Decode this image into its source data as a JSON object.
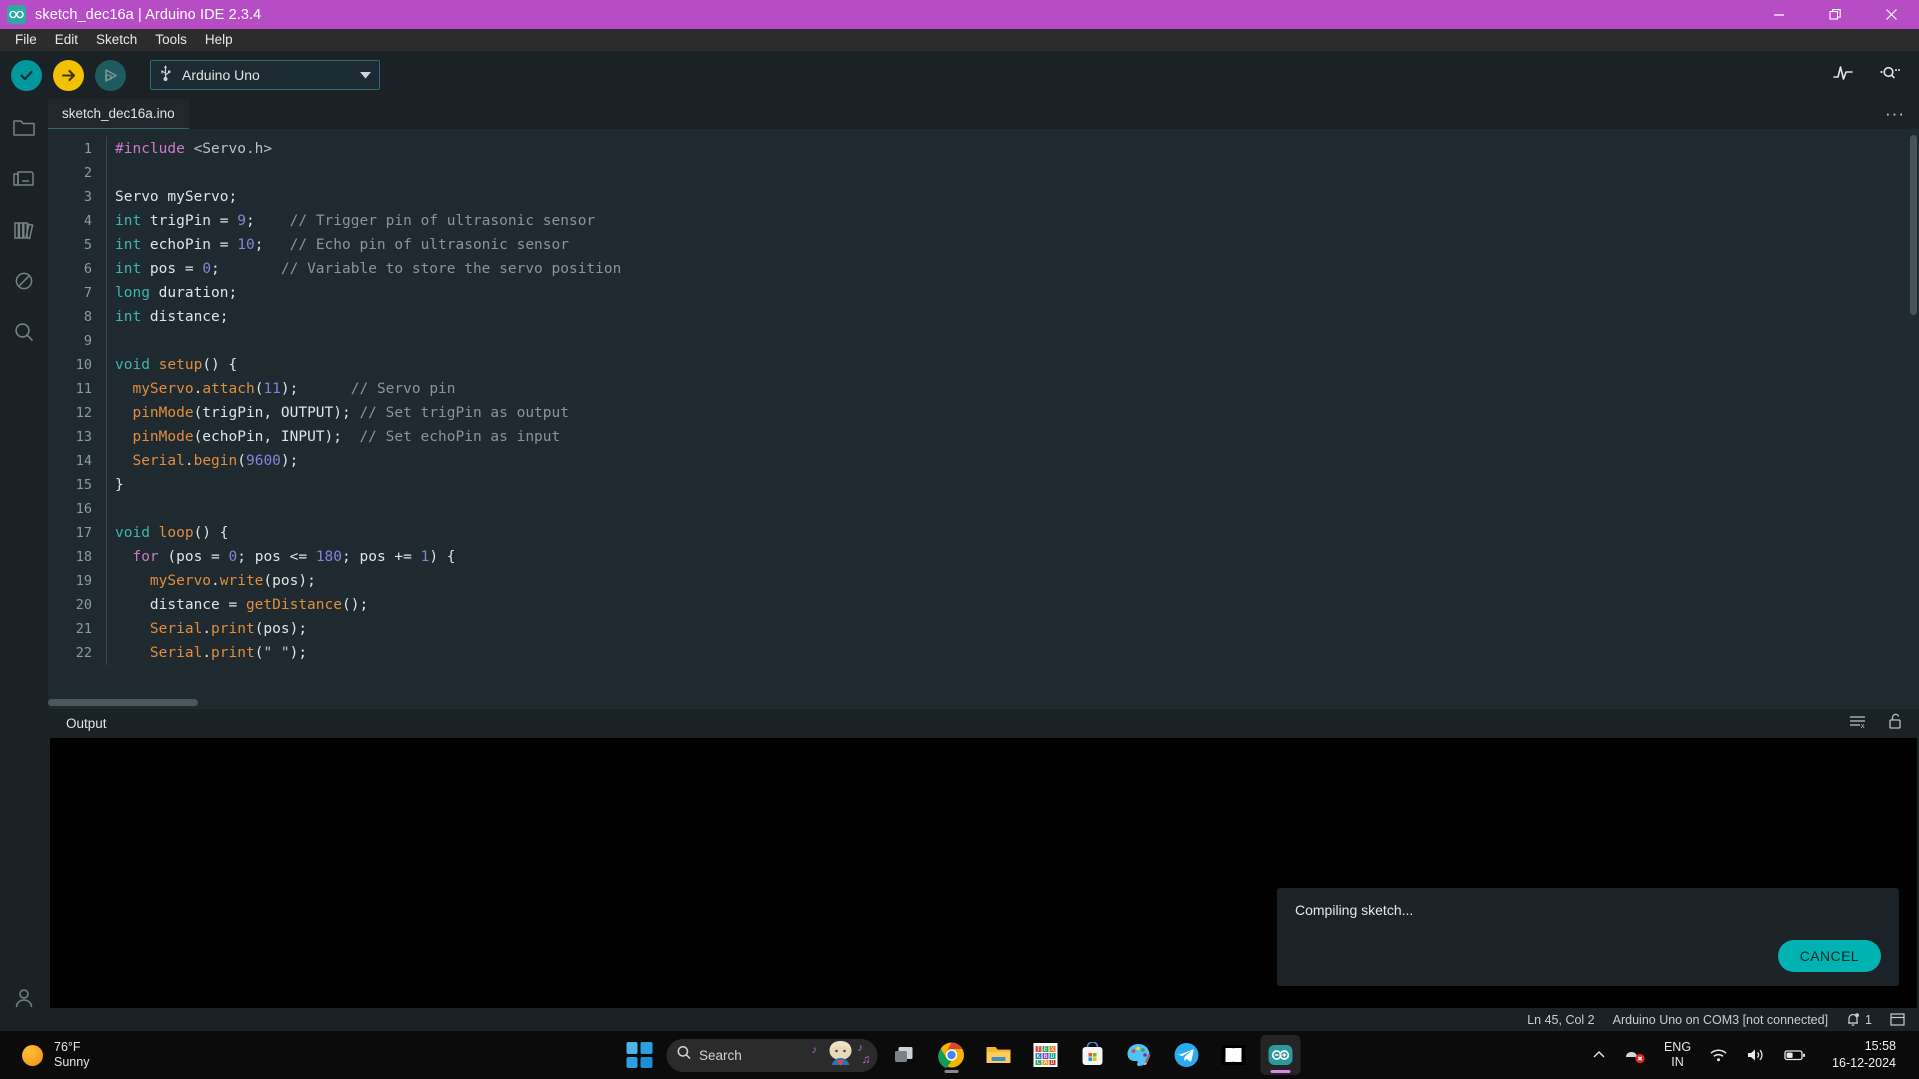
{
  "window": {
    "title": "sketch_dec16a | Arduino IDE 2.3.4",
    "logo_glyph": "∞",
    "minimize_glyph": "—",
    "restore_glyph": "❐",
    "close_glyph": "✕"
  },
  "menubar": {
    "items": [
      "File",
      "Edit",
      "Sketch",
      "Tools",
      "Help"
    ]
  },
  "toolbar": {
    "verify_tooltip": "Verify",
    "upload_tooltip": "Upload",
    "debug_tooltip": "Debug",
    "board_name": "Arduino Uno",
    "board_caret": "▼",
    "serial_plotter_tooltip": "Serial Plotter",
    "serial_monitor_tooltip": "Serial Monitor"
  },
  "activity_bar": {
    "items": [
      {
        "name": "sketchbook",
        "label": "Sketchbook"
      },
      {
        "name": "boards-manager",
        "label": "Boards Manager"
      },
      {
        "name": "library-manager",
        "label": "Library Manager"
      },
      {
        "name": "debug",
        "label": "Debug"
      },
      {
        "name": "search",
        "label": "Search"
      }
    ],
    "account_label": "Account"
  },
  "editor": {
    "tab_name": "sketch_dec16a.ino",
    "more_glyph": "···",
    "lines": [
      {
        "n": "1",
        "tokens": [
          {
            "t": "#include ",
            "c": "tok-pre"
          },
          {
            "t": "<Servo.h>",
            "c": "tok-str"
          }
        ]
      },
      {
        "n": "2",
        "tokens": []
      },
      {
        "n": "3",
        "tokens": [
          {
            "t": "Servo myServo;",
            "c": "tok-id"
          }
        ]
      },
      {
        "n": "4",
        "tokens": [
          {
            "t": "int",
            "c": "tok-kw"
          },
          {
            "t": " trigPin = ",
            "c": "tok-id"
          },
          {
            "t": "9",
            "c": "tok-num"
          },
          {
            "t": ";    ",
            "c": "tok-id"
          },
          {
            "t": "// Trigger pin of ultrasonic sensor",
            "c": "tok-com"
          }
        ]
      },
      {
        "n": "5",
        "tokens": [
          {
            "t": "int",
            "c": "tok-kw"
          },
          {
            "t": " echoPin = ",
            "c": "tok-id"
          },
          {
            "t": "10",
            "c": "tok-num"
          },
          {
            "t": ";   ",
            "c": "tok-id"
          },
          {
            "t": "// Echo pin of ultrasonic sensor",
            "c": "tok-com"
          }
        ]
      },
      {
        "n": "6",
        "tokens": [
          {
            "t": "int",
            "c": "tok-kw"
          },
          {
            "t": " pos = ",
            "c": "tok-id"
          },
          {
            "t": "0",
            "c": "tok-num"
          },
          {
            "t": ";       ",
            "c": "tok-id"
          },
          {
            "t": "// Variable to store the servo position",
            "c": "tok-com"
          }
        ]
      },
      {
        "n": "7",
        "tokens": [
          {
            "t": "long",
            "c": "tok-kw"
          },
          {
            "t": " duration;",
            "c": "tok-id"
          }
        ]
      },
      {
        "n": "8",
        "tokens": [
          {
            "t": "int",
            "c": "tok-kw"
          },
          {
            "t": " distance;",
            "c": "tok-id"
          }
        ]
      },
      {
        "n": "9",
        "tokens": []
      },
      {
        "n": "10",
        "tokens": [
          {
            "t": "void",
            "c": "tok-kw"
          },
          {
            "t": " ",
            "c": "tok-id"
          },
          {
            "t": "setup",
            "c": "tok-fn"
          },
          {
            "t": "() {",
            "c": "tok-id"
          }
        ]
      },
      {
        "n": "11",
        "tokens": [
          {
            "t": "  ",
            "c": "tok-id"
          },
          {
            "t": "myServo",
            "c": "tok-fn"
          },
          {
            "t": ".",
            "c": "tok-id"
          },
          {
            "t": "attach",
            "c": "tok-fn"
          },
          {
            "t": "(",
            "c": "tok-id"
          },
          {
            "t": "11",
            "c": "tok-num"
          },
          {
            "t": ");      ",
            "c": "tok-id"
          },
          {
            "t": "// Servo pin",
            "c": "tok-com"
          }
        ]
      },
      {
        "n": "12",
        "tokens": [
          {
            "t": "  ",
            "c": "tok-id"
          },
          {
            "t": "pinMode",
            "c": "tok-fn"
          },
          {
            "t": "(trigPin, OUTPUT); ",
            "c": "tok-id"
          },
          {
            "t": "// Set trigPin as output",
            "c": "tok-com"
          }
        ]
      },
      {
        "n": "13",
        "tokens": [
          {
            "t": "  ",
            "c": "tok-id"
          },
          {
            "t": "pinMode",
            "c": "tok-fn"
          },
          {
            "t": "(echoPin, INPUT);  ",
            "c": "tok-id"
          },
          {
            "t": "// Set echoPin as input",
            "c": "tok-com"
          }
        ]
      },
      {
        "n": "14",
        "tokens": [
          {
            "t": "  ",
            "c": "tok-id"
          },
          {
            "t": "Serial",
            "c": "tok-fn"
          },
          {
            "t": ".",
            "c": "tok-id"
          },
          {
            "t": "begin",
            "c": "tok-fn"
          },
          {
            "t": "(",
            "c": "tok-id"
          },
          {
            "t": "9600",
            "c": "tok-num"
          },
          {
            "t": ");",
            "c": "tok-id"
          }
        ]
      },
      {
        "n": "15",
        "tokens": [
          {
            "t": "}",
            "c": "tok-id"
          }
        ]
      },
      {
        "n": "16",
        "tokens": []
      },
      {
        "n": "17",
        "tokens": [
          {
            "t": "void",
            "c": "tok-kw"
          },
          {
            "t": " ",
            "c": "tok-id"
          },
          {
            "t": "loop",
            "c": "tok-fn"
          },
          {
            "t": "() {",
            "c": "tok-id"
          }
        ]
      },
      {
        "n": "18",
        "tokens": [
          {
            "t": "  ",
            "c": "tok-id"
          },
          {
            "t": "for",
            "c": "tok-ctrl"
          },
          {
            "t": " (pos = ",
            "c": "tok-id"
          },
          {
            "t": "0",
            "c": "tok-num"
          },
          {
            "t": "; pos <= ",
            "c": "tok-id"
          },
          {
            "t": "180",
            "c": "tok-num"
          },
          {
            "t": "; pos += ",
            "c": "tok-id"
          },
          {
            "t": "1",
            "c": "tok-num"
          },
          {
            "t": ") {",
            "c": "tok-id"
          }
        ]
      },
      {
        "n": "19",
        "tokens": [
          {
            "t": "    ",
            "c": "tok-id"
          },
          {
            "t": "myServo",
            "c": "tok-fn"
          },
          {
            "t": ".",
            "c": "tok-id"
          },
          {
            "t": "write",
            "c": "tok-fn"
          },
          {
            "t": "(pos);",
            "c": "tok-id"
          }
        ]
      },
      {
        "n": "20",
        "tokens": [
          {
            "t": "    distance = ",
            "c": "tok-id"
          },
          {
            "t": "getDistance",
            "c": "tok-fn"
          },
          {
            "t": "();",
            "c": "tok-id"
          }
        ]
      },
      {
        "n": "21",
        "tokens": [
          {
            "t": "    ",
            "c": "tok-id"
          },
          {
            "t": "Serial",
            "c": "tok-fn"
          },
          {
            "t": ".",
            "c": "tok-id"
          },
          {
            "t": "print",
            "c": "tok-fn"
          },
          {
            "t": "(pos);",
            "c": "tok-id"
          }
        ]
      },
      {
        "n": "22",
        "tokens": [
          {
            "t": "    ",
            "c": "tok-id"
          },
          {
            "t": "Serial",
            "c": "tok-fn"
          },
          {
            "t": ".",
            "c": "tok-id"
          },
          {
            "t": "print",
            "c": "tok-fn"
          },
          {
            "t": "(",
            "c": "tok-id"
          },
          {
            "t": "\" \"",
            "c": "tok-str"
          },
          {
            "t": ");",
            "c": "tok-id"
          }
        ]
      }
    ]
  },
  "output_panel": {
    "title": "Output",
    "clear_tooltip": "Clear Output",
    "lock_tooltip": "Toggle Auto Scroll",
    "content": ""
  },
  "toast": {
    "message": "Compiling sketch...",
    "cancel_label": "CANCEL"
  },
  "statusbar": {
    "cursor": "Ln 45, Col 2",
    "board_status": "Arduino Uno on COM3 [not connected]",
    "notification_count": "1"
  },
  "taskbar": {
    "weather": {
      "temperature": "76°F",
      "condition": "Sunny"
    },
    "search_placeholder": "Search",
    "apps": [
      {
        "name": "task-view",
        "label": "Task View"
      },
      {
        "name": "google-chrome",
        "label": "Google Chrome"
      },
      {
        "name": "file-explorer",
        "label": "File Explorer"
      },
      {
        "name": "keyboard-app",
        "label": "Keyboard App"
      },
      {
        "name": "microsoft-store",
        "label": "Microsoft Store"
      },
      {
        "name": "paint",
        "label": "Paint"
      },
      {
        "name": "telegram",
        "label": "Telegram"
      },
      {
        "name": "dolby",
        "label": "Dolby"
      },
      {
        "name": "arduino-ide",
        "label": "Arduino IDE"
      }
    ],
    "tray": {
      "chevron": "⌃",
      "language_primary": "ENG",
      "language_secondary": "IN",
      "time": "15:58",
      "date": "16-12-2024"
    }
  }
}
